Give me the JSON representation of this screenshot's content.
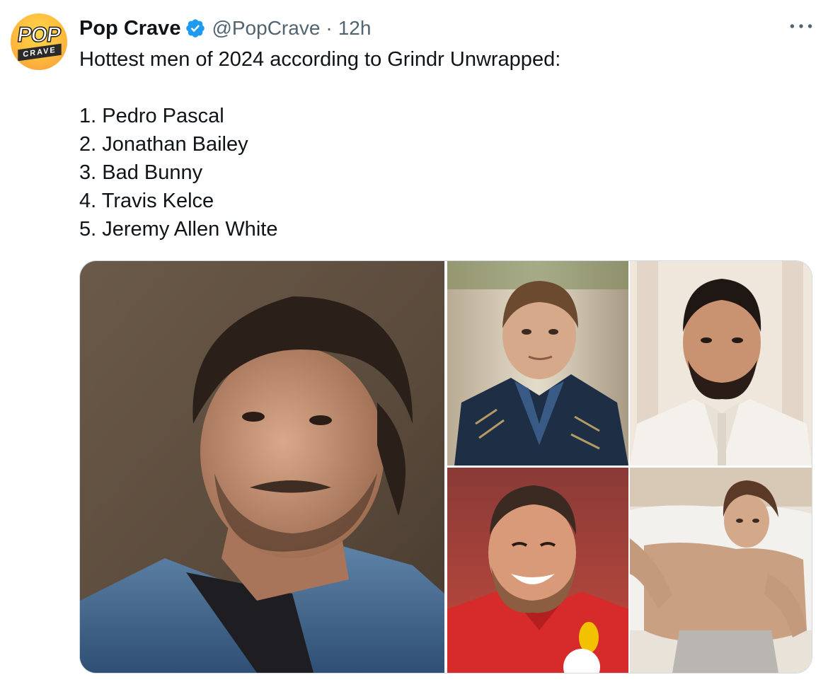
{
  "account": {
    "display_name": "Pop Crave",
    "handle": "@PopCrave",
    "separator": "·",
    "time": "12h",
    "verified": true,
    "avatar_text_top": "POP",
    "avatar_text_bottom": "CRAVE",
    "verified_color": "#1d9bf0"
  },
  "tweet": {
    "headline": "Hottest men of 2024 according to Grindr Unwrapped:",
    "list": [
      "1. Pedro Pascal",
      "2. Jonathan Bailey",
      "3. Bad Bunny",
      "4. Travis Kelce",
      "5. Jeremy Allen White"
    ]
  },
  "media": {
    "photos": [
      {
        "subject": "Pedro Pascal portrait, denim jacket"
      },
      {
        "subject": "Jonathan Bailey in dark embroidered coat"
      },
      {
        "subject": "Bad Bunny in white suit"
      },
      {
        "subject": "Travis Kelce smiling in red jersey"
      },
      {
        "subject": "Jeremy Allen White reclining on bed"
      }
    ]
  },
  "icons": {
    "more": "more-horizontal-icon",
    "verified": "verified-badge-icon"
  }
}
